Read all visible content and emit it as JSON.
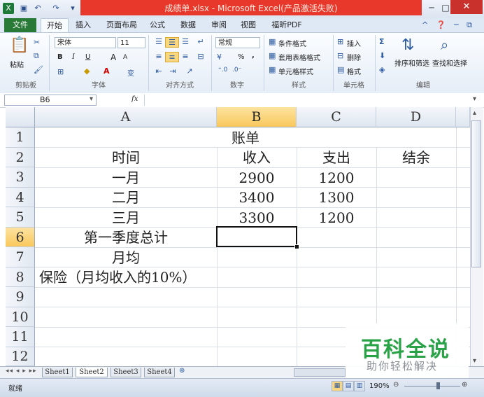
{
  "window": {
    "title": "成绩单.xlsx - Microsoft Excel(产品激活失败)",
    "min_btn": "─",
    "max_btn": "□",
    "close_btn": "✕"
  },
  "ribbon_tabs": [
    "开始",
    "插入",
    "页面布局",
    "公式",
    "数据",
    "审阅",
    "视图",
    "福昕PDF"
  ],
  "file_tab": "文件",
  "ribbon": {
    "clipboard": {
      "paste": "粘贴",
      "label": "剪贴板"
    },
    "font": {
      "name": "宋体",
      "size": "11",
      "label": "字体",
      "bold": "B",
      "italic": "I",
      "underline": "U",
      "grow": "A",
      "shrink": "A",
      "wen": "变"
    },
    "alignment": {
      "label": "对齐方式"
    },
    "number": {
      "format": "常规",
      "label": "数字",
      "percent": "%",
      "comma": ","
    },
    "styles": {
      "cond": "条件格式",
      "table": "套用表格格式",
      "cell": "单元格样式",
      "label": "样式"
    },
    "cells": {
      "insert": "插入",
      "delete": "删除",
      "format": "格式",
      "label": "单元格"
    },
    "editing": {
      "sort": "排序和筛选",
      "find": "查找和选择",
      "label": "编辑"
    }
  },
  "formula_bar": {
    "name_box": "B6",
    "fx": "fx",
    "content": ""
  },
  "columns": [
    "A",
    "B",
    "C",
    "D"
  ],
  "rows": [
    "1",
    "2",
    "3",
    "4",
    "5",
    "6",
    "7",
    "8",
    "9",
    "10",
    "11",
    "12"
  ],
  "cells": {
    "title": "账单",
    "a2": "时间",
    "b2": "收入",
    "c2": "支出",
    "d2": "结余",
    "a3": "一月",
    "b3": "2900",
    "c3": "1200",
    "a4": "二月",
    "b4": "3400",
    "c4": "1300",
    "a5": "三月",
    "b5": "3300",
    "c5": "1200",
    "a6": "第一季度总计",
    "a7": "月均",
    "a8": "保险（月均收入的10%）"
  },
  "sheets": [
    "Sheet1",
    "Sheet2",
    "Sheet3",
    "Sheet4"
  ],
  "active_sheet": "Sheet2",
  "status": {
    "ready": "就绪",
    "zoom": "190%"
  },
  "watermark": {
    "title": "百科全说",
    "subtitle": "助你轻松解决"
  },
  "colors": {
    "accent": "#2a7a37",
    "selection_header": "#f9c85c",
    "title_bar_alert": "#e8382c"
  }
}
